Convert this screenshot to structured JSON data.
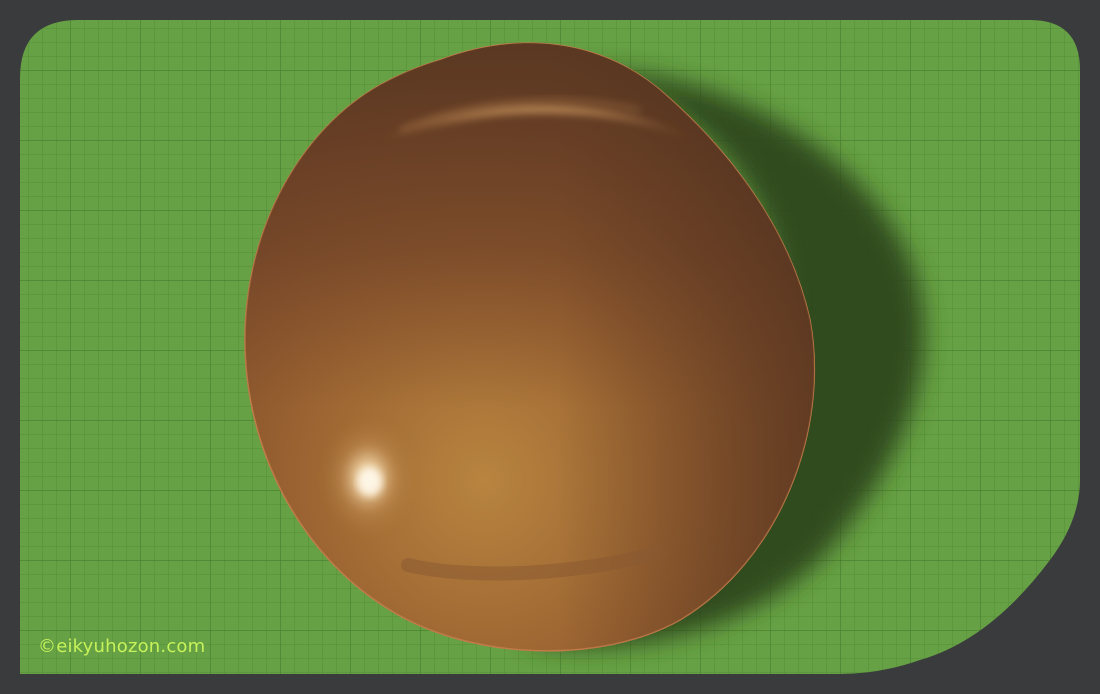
{
  "image": {
    "subject": "chestnut-illustration",
    "colors": {
      "frame": "#3a3b3d",
      "mat": "#67a145",
      "grid": "#4f8a34",
      "chestnut_light": "#b07c3c",
      "chestnut_mid": "#8a5430",
      "chestnut_dark": "#5a3420",
      "shadow": "#2f461e",
      "credit_text": "#c6f25a"
    }
  },
  "credit": {
    "text": "©eikyuhozon.com"
  }
}
